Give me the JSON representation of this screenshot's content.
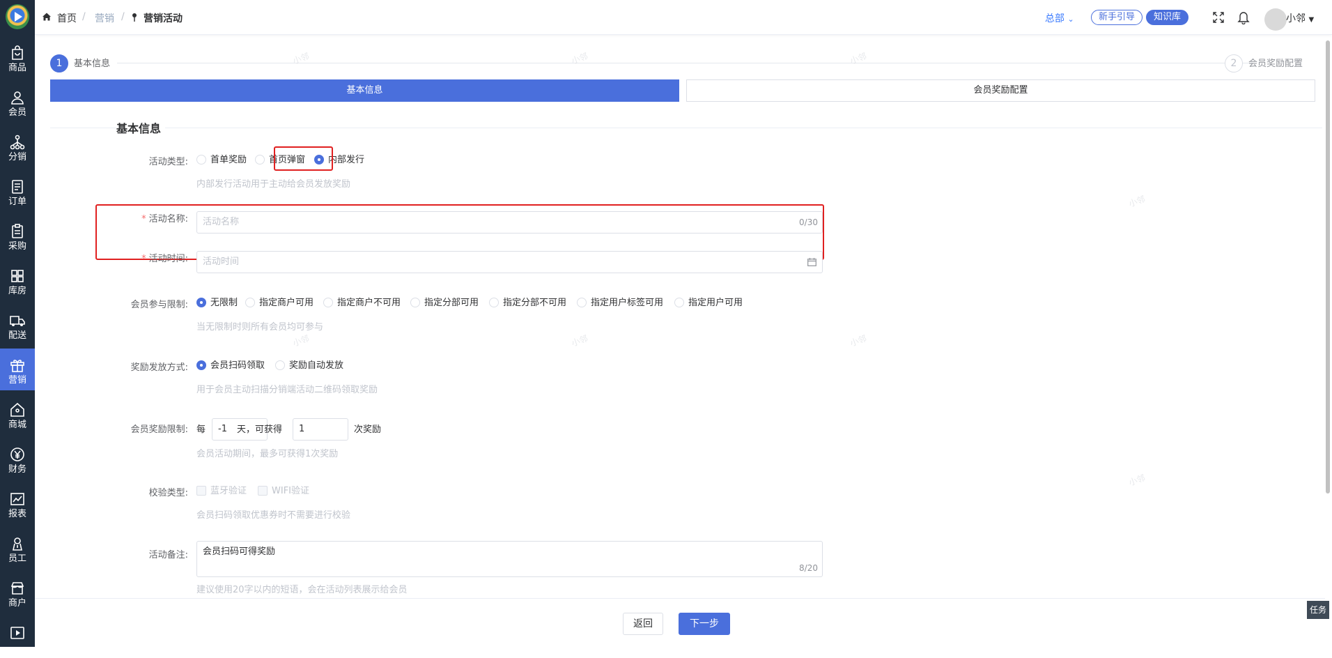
{
  "sidebar": {
    "items": [
      {
        "label": "商品",
        "icon": "bag-icon"
      },
      {
        "label": "会员",
        "icon": "user-icon"
      },
      {
        "label": "分销",
        "icon": "share-tree-icon"
      },
      {
        "label": "订单",
        "icon": "order-doc-icon"
      },
      {
        "label": "采购",
        "icon": "purchase-doc-icon"
      },
      {
        "label": "库房",
        "icon": "warehouse-grid-icon"
      },
      {
        "label": "配送",
        "icon": "truck-icon"
      },
      {
        "label": "营销",
        "icon": "gift-icon"
      },
      {
        "label": "商城",
        "icon": "home-icon"
      },
      {
        "label": "财务",
        "icon": "yen-icon"
      },
      {
        "label": "报表",
        "icon": "chart-icon"
      },
      {
        "label": "员工",
        "icon": "staff-icon"
      },
      {
        "label": "商户",
        "icon": "shop-icon"
      },
      {
        "label": "",
        "icon": "play-icon"
      }
    ],
    "active_index": 7,
    "active_color": "#4a6fdc"
  },
  "header": {
    "breadcrumb": [
      "首页",
      "营销",
      "营销活动"
    ],
    "branch": "总部",
    "guide_btn": "新手引导",
    "kb_btn": "知识库",
    "user": "小邻"
  },
  "steps": [
    {
      "num": "1",
      "title": "基本信息"
    },
    {
      "num": "2",
      "title": "会员奖励配置"
    }
  ],
  "tabs": [
    "基本信息",
    "会员奖励配置"
  ],
  "section_title": "基本信息",
  "form": {
    "activity_type": {
      "label": "活动类型:",
      "options": [
        "首单奖励",
        "首页弹窗",
        "内部发行"
      ],
      "selected": "内部发行",
      "hint": "内部发行活动用于主动给会员发放奖励"
    },
    "activity_name": {
      "label": "活动名称:",
      "placeholder": "活动名称",
      "count": "0/30"
    },
    "activity_time": {
      "label": "活动时间:",
      "placeholder": "活动时间"
    },
    "member_limit": {
      "label": "会员参与限制:",
      "options": [
        "无限制",
        "指定商户可用",
        "指定商户不可用",
        "指定分部可用",
        "指定分部不可用",
        "指定用户标签可用",
        "指定用户可用"
      ],
      "selected": "无限制",
      "hint": "当无限制时则所有会员均可参与"
    },
    "reward_method": {
      "label": "奖励发放方式:",
      "options": [
        "会员扫码领取",
        "奖励自动发放"
      ],
      "selected": "会员扫码领取",
      "hint": "用于会员主动扫描分销端活动二维码领取奖励"
    },
    "reward_limit": {
      "label": "会员奖励限制:",
      "prefix": "每",
      "days_value": "-1",
      "middle": "天，可获得",
      "times_value": "1",
      "suffix": "次奖励",
      "hint": "会员活动期间，最多可获得1次奖励"
    },
    "verify_type": {
      "label": "校验类型:",
      "options": [
        "蓝牙验证",
        "WIFI验证"
      ],
      "hint": "会员扫码领取优惠券时不需要进行校验"
    },
    "remark": {
      "label": "活动备注:",
      "value": "会员扫码可得奖励",
      "count": "8/20",
      "hint": "建议使用20字以内的短语，会在活动列表展示给会员"
    }
  },
  "footer": {
    "back": "返回",
    "next": "下一步"
  },
  "task_btn": "任务",
  "watermark": "小邻"
}
